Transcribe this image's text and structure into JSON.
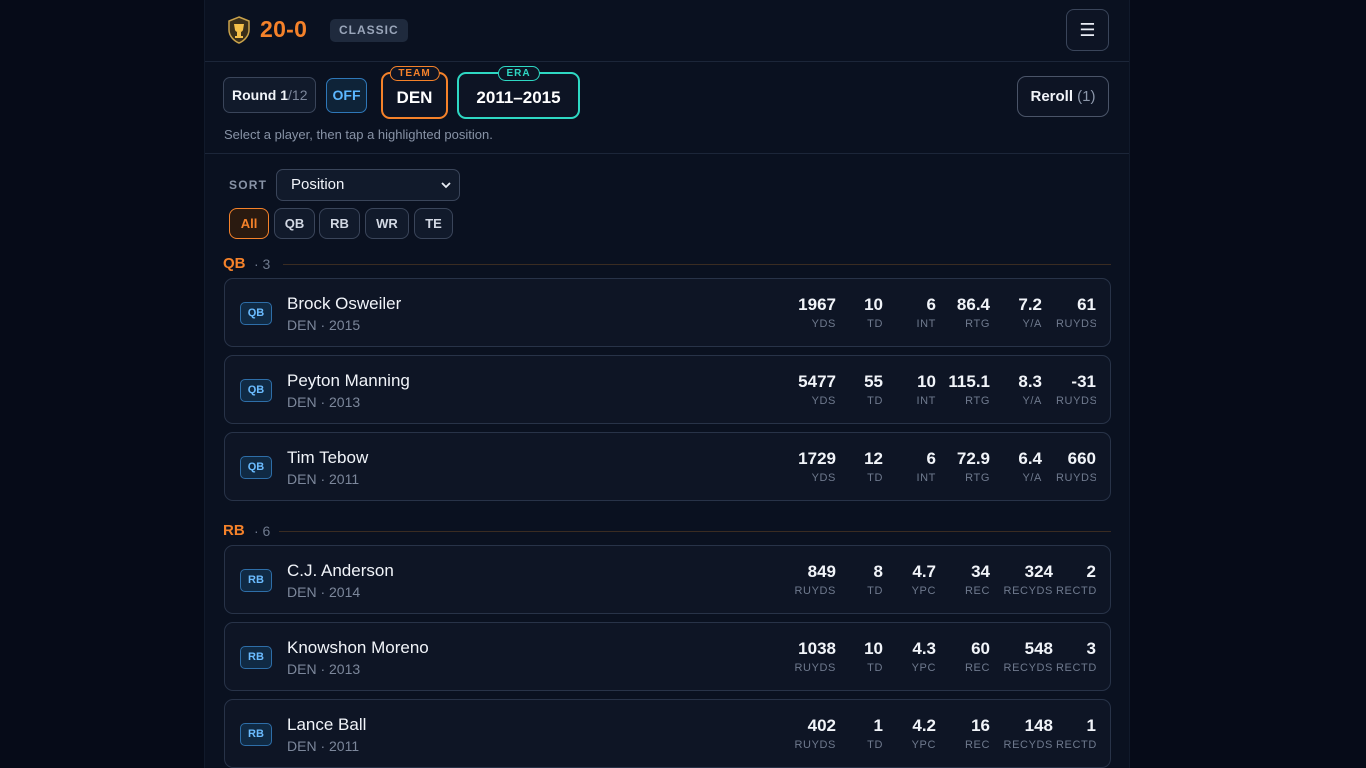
{
  "header": {
    "brand": "20-0",
    "mode": "CLASSIC",
    "menu_icon": "☰"
  },
  "roundbar": {
    "round_label": "Round",
    "round_current": "1",
    "round_total": "/12",
    "side": "OFF",
    "team_tag": "TEAM",
    "team": "DEN",
    "era_tag": "ERA",
    "era": "2011–2015",
    "reroll_label": "Reroll",
    "reroll_count": "(1)",
    "hint": "Select a player, then tap a highlighted position."
  },
  "sort": {
    "label": "SORT",
    "selected": "Position"
  },
  "filters": [
    "All",
    "QB",
    "RB",
    "WR",
    "TE"
  ],
  "groups": [
    {
      "name": "QB",
      "count": "· 3",
      "players": [
        {
          "pos": "QB",
          "name": "Brock Osweiler",
          "meta": "DEN · 2015",
          "stats": [
            {
              "v": "1967",
              "k": "YDS"
            },
            {
              "v": "10",
              "k": "TD"
            },
            {
              "v": "6",
              "k": "INT"
            },
            {
              "v": "86.4",
              "k": "RTG"
            },
            {
              "v": "7.2",
              "k": "Y/A"
            },
            {
              "v": "61",
              "k": "RUYDS"
            }
          ]
        },
        {
          "pos": "QB",
          "name": "Peyton Manning",
          "meta": "DEN · 2013",
          "stats": [
            {
              "v": "5477",
              "k": "YDS"
            },
            {
              "v": "55",
              "k": "TD"
            },
            {
              "v": "10",
              "k": "INT"
            },
            {
              "v": "115.1",
              "k": "RTG"
            },
            {
              "v": "8.3",
              "k": "Y/A"
            },
            {
              "v": "-31",
              "k": "RUYDS"
            }
          ]
        },
        {
          "pos": "QB",
          "name": "Tim Tebow",
          "meta": "DEN · 2011",
          "stats": [
            {
              "v": "1729",
              "k": "YDS"
            },
            {
              "v": "12",
              "k": "TD"
            },
            {
              "v": "6",
              "k": "INT"
            },
            {
              "v": "72.9",
              "k": "RTG"
            },
            {
              "v": "6.4",
              "k": "Y/A"
            },
            {
              "v": "660",
              "k": "RUYDS"
            }
          ]
        }
      ]
    },
    {
      "name": "RB",
      "count": "· 6",
      "players": [
        {
          "pos": "RB",
          "name": "C.J. Anderson",
          "meta": "DEN · 2014",
          "stats": [
            {
              "v": "849",
              "k": "RUYDS"
            },
            {
              "v": "8",
              "k": "TD"
            },
            {
              "v": "4.7",
              "k": "YPC"
            },
            {
              "v": "34",
              "k": "REC"
            },
            {
              "v": "324",
              "k": "RECYDS"
            },
            {
              "v": "2",
              "k": "RECTD"
            }
          ]
        },
        {
          "pos": "RB",
          "name": "Knowshon Moreno",
          "meta": "DEN · 2013",
          "stats": [
            {
              "v": "1038",
              "k": "RUYDS"
            },
            {
              "v": "10",
              "k": "TD"
            },
            {
              "v": "4.3",
              "k": "YPC"
            },
            {
              "v": "60",
              "k": "REC"
            },
            {
              "v": "548",
              "k": "RECYDS"
            },
            {
              "v": "3",
              "k": "RECTD"
            }
          ]
        },
        {
          "pos": "RB",
          "name": "Lance Ball",
          "meta": "DEN · 2011",
          "stats": [
            {
              "v": "402",
              "k": "RUYDS"
            },
            {
              "v": "1",
              "k": "TD"
            },
            {
              "v": "4.2",
              "k": "YPC"
            },
            {
              "v": "16",
              "k": "REC"
            },
            {
              "v": "148",
              "k": "RECYDS"
            },
            {
              "v": "1",
              "k": "RECTD"
            }
          ]
        }
      ]
    }
  ]
}
